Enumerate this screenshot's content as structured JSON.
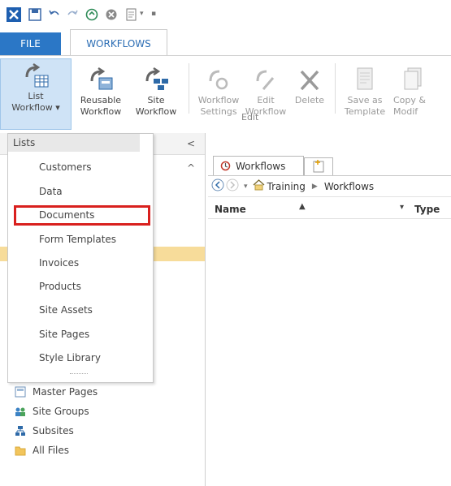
{
  "quick_access": {
    "icons": [
      "app-logo-icon",
      "save-icon",
      "undo-icon",
      "redo-icon",
      "sync-icon",
      "stop-icon",
      "preview-in-browser-icon",
      "customize-qat-icon"
    ]
  },
  "ribbon": {
    "tabs": [
      {
        "label": "FILE"
      },
      {
        "label": "WORKFLOWS"
      }
    ],
    "buttons": {
      "list_workflow": {
        "line1": "List",
        "line2": "Workflow ▾"
      },
      "reusable_workflow": {
        "line1": "Reusable",
        "line2": "Workflow"
      },
      "site_workflow": {
        "line1": "Site",
        "line2": "Workflow"
      },
      "workflow_settings": {
        "line1": "Workflow",
        "line2": "Settings"
      },
      "edit_workflow": {
        "line1": "Edit",
        "line2": "Workflow"
      },
      "delete": {
        "line1": "Delete",
        "line2": ""
      },
      "save_as_template": {
        "line1": "Save as",
        "line2": "Template"
      },
      "copy_modify": {
        "line1": "Copy &",
        "line2": "Modif"
      }
    },
    "group_label_edit": "Edit"
  },
  "dropdown": {
    "header": "Lists",
    "items": [
      "Customers",
      "Data",
      "Documents",
      "Form Templates",
      "Invoices",
      "Products",
      "Site Assets",
      "Site Pages",
      "Style Library"
    ],
    "highlighted": "Documents"
  },
  "navigation": {
    "collapse_glyph": "<",
    "scroll_up_glyph": "^",
    "items": [
      {
        "label": "Master Pages",
        "icon": "master-pages-icon"
      },
      {
        "label": "Site Groups",
        "icon": "site-groups-icon"
      },
      {
        "label": "Subsites",
        "icon": "subsites-icon"
      },
      {
        "label": "All Files",
        "icon": "folder-icon"
      }
    ]
  },
  "content": {
    "tab_label": "Workflows",
    "breadcrumb": [
      "Training",
      "Workflows"
    ],
    "breadcrumb_sep": "▶",
    "columns": {
      "name": "Name",
      "type": "Type"
    },
    "sort_glyph": "▲",
    "filter_glyph": "▾"
  },
  "colors": {
    "file_tab": "#2b77c6",
    "selected_button": "#cfe3f6",
    "highlight_bar": "#f7dc9a",
    "red_box": "#d9201e"
  }
}
